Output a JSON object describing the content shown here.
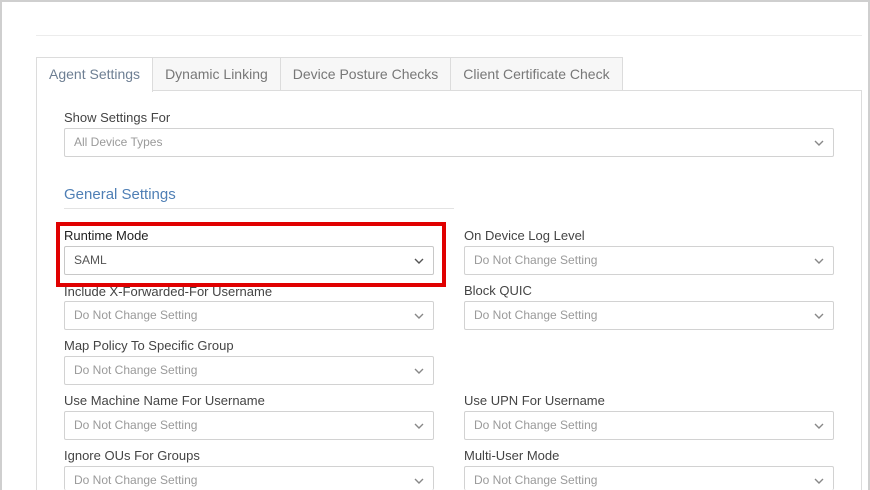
{
  "tabs": [
    {
      "label": "Agent Settings"
    },
    {
      "label": "Dynamic Linking"
    },
    {
      "label": "Device Posture Checks"
    },
    {
      "label": "Client Certificate Check"
    }
  ],
  "show_settings": {
    "label": "Show Settings For",
    "value": "All Device Types"
  },
  "section_title": "General Settings",
  "fields": {
    "runtime_mode": {
      "label": "Runtime Mode",
      "value": "SAML"
    },
    "on_device_log_level": {
      "label": "On Device Log Level",
      "value": "Do Not Change Setting"
    },
    "include_x_forwarded": {
      "label": "Include X-Forwarded-For Username",
      "value": "Do Not Change Setting"
    },
    "block_quic": {
      "label": "Block QUIC",
      "value": "Do Not Change Setting"
    },
    "map_policy": {
      "label": "Map Policy To Specific Group",
      "value": "Do Not Change Setting"
    },
    "use_machine_name": {
      "label": "Use Machine Name For Username",
      "value": "Do Not Change Setting"
    },
    "use_upn": {
      "label": "Use UPN For Username",
      "value": "Do Not Change Setting"
    },
    "ignore_ous": {
      "label": "Ignore OUs For Groups",
      "value": "Do Not Change Setting"
    },
    "multi_user_mode": {
      "label": "Multi-User Mode",
      "value": "Do Not Change Setting"
    }
  },
  "icons": {
    "dropdown": "chevron-down-icon"
  },
  "colors": {
    "highlight": "#e00000",
    "section_title": "#4f7fb5"
  }
}
